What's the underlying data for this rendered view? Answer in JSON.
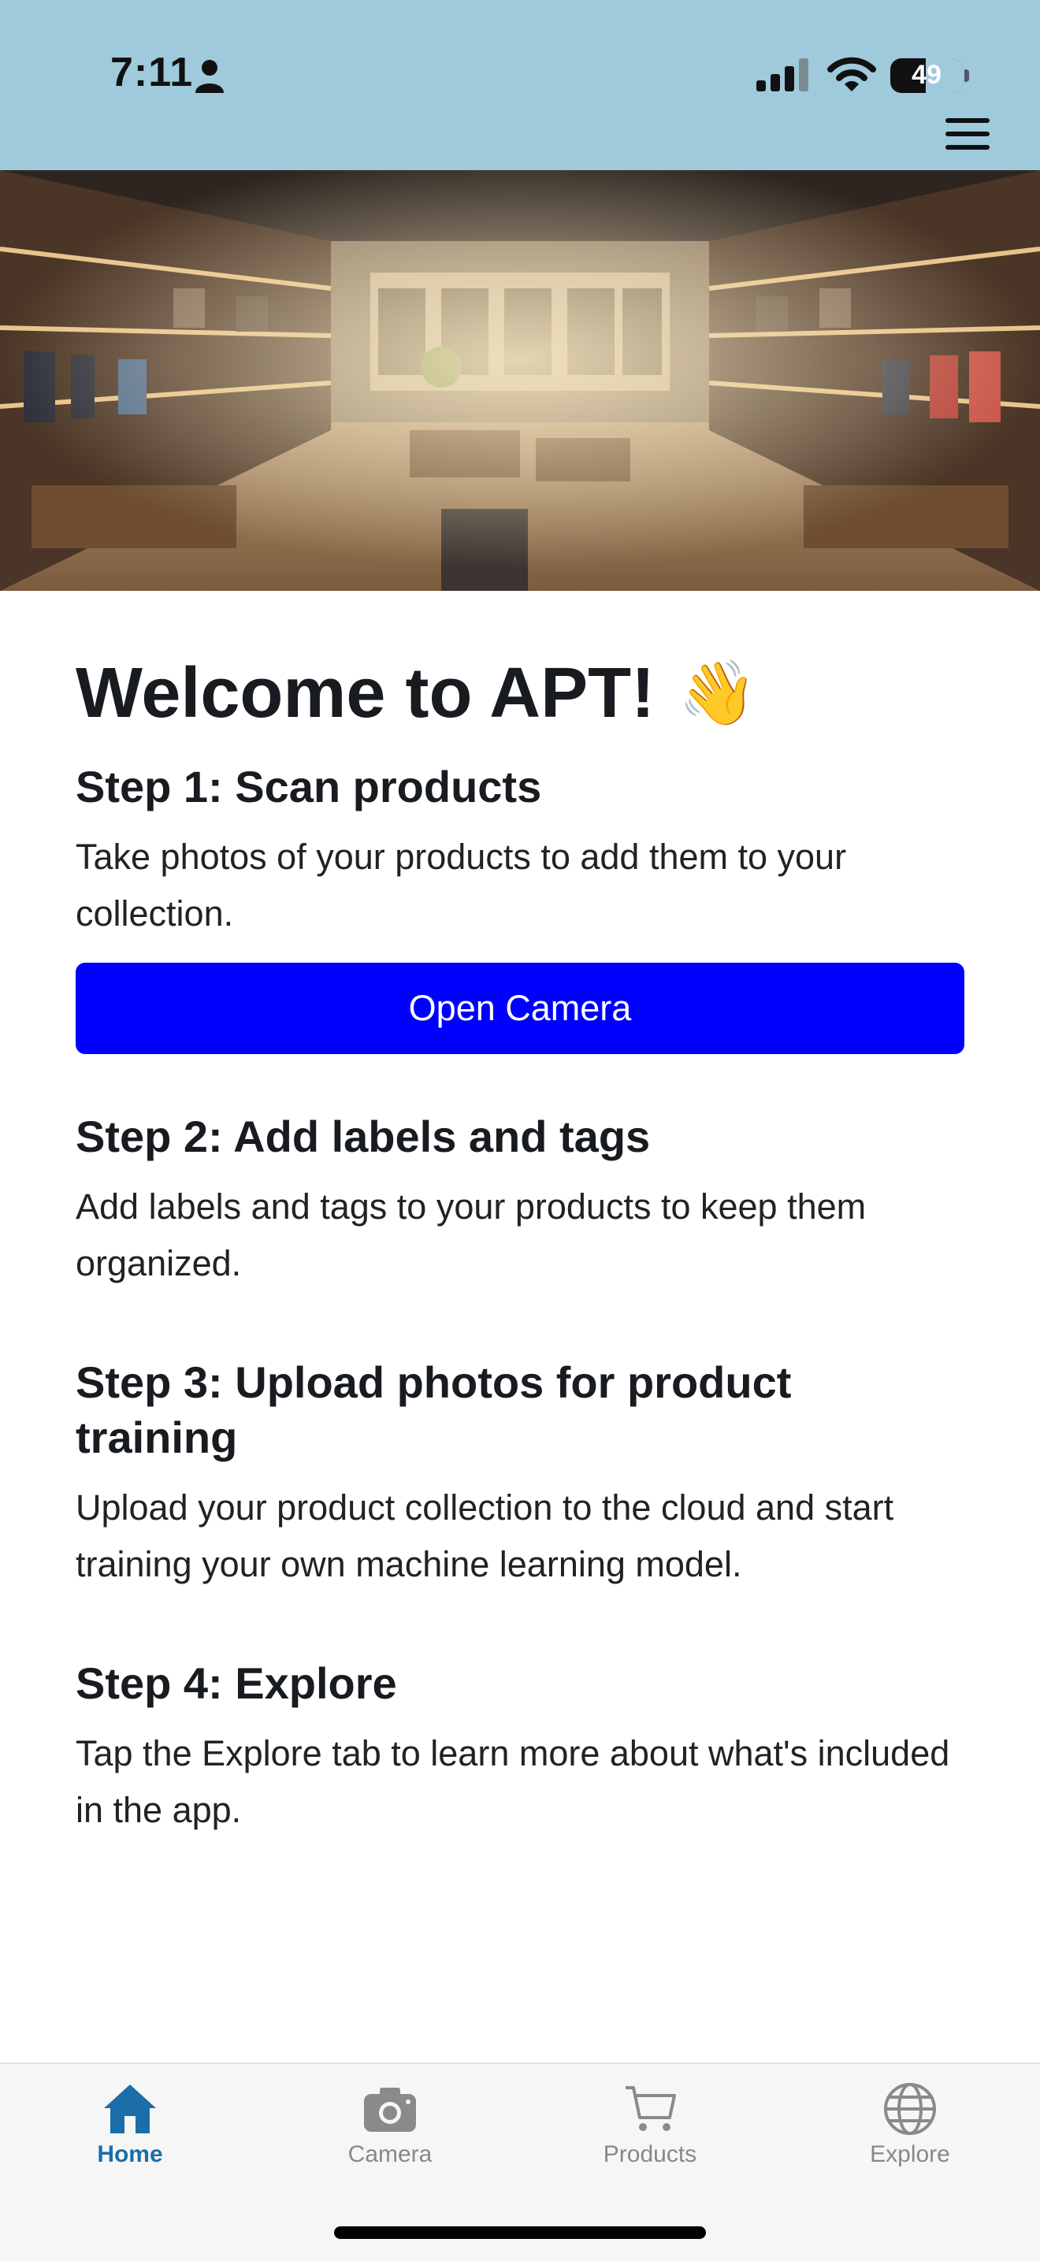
{
  "status_bar": {
    "time": "7:11",
    "battery_level": "49"
  },
  "header": {
    "background_color": "#9fcadc",
    "menu_icon": "hamburger-menu-icon"
  },
  "hero": {
    "image_subject": "interior of a retail store with lit shelves"
  },
  "main": {
    "title": "Welcome to APT!",
    "title_emoji": "👋",
    "steps": [
      {
        "title": "Step 1: Scan products",
        "text": "Take photos of your products to add them to your collection."
      },
      {
        "title": "Step 2: Add labels and tags",
        "text": "Add labels and tags to your products to keep them organized."
      },
      {
        "title": "Step 3: Upload photos for product training",
        "text": "Upload your product collection to the cloud and start training your own machine learning model."
      },
      {
        "title": "Step 4: Explore",
        "text": "Tap the Explore tab to learn more about what's included in the app."
      }
    ],
    "open_camera_label": "Open Camera",
    "button_color": "#0000ff"
  },
  "tab_bar": {
    "active_color": "#1b6ea8",
    "inactive_color": "#888888",
    "tabs": [
      {
        "label": "Home",
        "icon": "home-icon",
        "active": true
      },
      {
        "label": "Camera",
        "icon": "camera-icon",
        "active": false
      },
      {
        "label": "Products",
        "icon": "cart-icon",
        "active": false
      },
      {
        "label": "Explore",
        "icon": "globe-icon",
        "active": false
      }
    ]
  }
}
